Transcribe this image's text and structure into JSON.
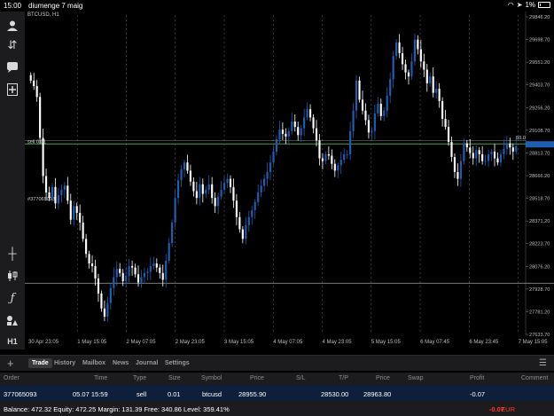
{
  "status_bar": {
    "time": "15:00",
    "date": "diumenge 7 maig",
    "battery": "1%"
  },
  "chart": {
    "symbol_title": "BTCUSD, H1",
    "price_labels": [
      "29846.20",
      "29698.70",
      "29551.20",
      "29403.70",
      "29256.20",
      "29108.70",
      "28813.70",
      "28666.20",
      "28518.70",
      "28371.20",
      "28223.70",
      "28076.20",
      "27928.70",
      "27781.20",
      "27633.70"
    ],
    "time_labels": [
      "30 Apr 23:05",
      "1 May 15:05",
      "2 May 07:05",
      "2 May 23:05",
      "3 May 15:05",
      "4 May 07:05",
      "4 May 23:05",
      "5 May 15:05",
      "6 May 07:45",
      "6 May 23:45",
      "7 May 15:05"
    ],
    "sell_line_label": "sell 0.01",
    "order_label": "#377065093",
    "level_value": "50.0",
    "colors": {
      "bull": "#1e5fb4",
      "bear": "#ffffff",
      "sell_line": "#3ea84b",
      "level_line": "#8a8a8a",
      "bid_tag": "#1e5fb4"
    }
  },
  "tabs": [
    "Trade",
    "History",
    "Mailbox",
    "News",
    "Journal",
    "Settings"
  ],
  "columns": [
    "Order",
    "Time",
    "Type",
    "Size",
    "Symbol",
    "Price",
    "S/L",
    "T/P",
    "Price",
    "Swap",
    "Profit",
    "Comment"
  ],
  "trade": {
    "order": "377065093",
    "time": "05.07 15:59",
    "type": "sell",
    "size": "0.01",
    "symbol": "btcusd",
    "price": "28955.90",
    "sl": "",
    "tp": "28530.00",
    "current_price": "28963.80",
    "swap": "",
    "profit": "-0.07",
    "comment": ""
  },
  "balance": {
    "text": "Balance: 472.32 Equity: 472.25 Margin: 131.39 Free: 340.86 Level: 359.41%",
    "profit": "-0.07",
    "currency": "EUR"
  },
  "chart_data": {
    "type": "candlestick",
    "title": "BTCUSD, H1",
    "ylim": [
      27560,
      29900
    ],
    "sell_price": 28955.9,
    "grid": true,
    "closes": [
      29420,
      29380,
      29300,
      29000,
      28720,
      28600,
      28560,
      28640,
      28520,
      28580,
      28620,
      28650,
      28540,
      28400,
      28500,
      28450,
      28380,
      28260,
      28150,
      28080,
      28060,
      27970,
      27860,
      27750,
      27690,
      27790,
      27900,
      27980,
      28040,
      28010,
      27950,
      27990,
      28060,
      28050,
      28000,
      27940,
      27980,
      28010,
      28020,
      28060,
      28080,
      28050,
      28010,
      27960,
      28100,
      28230,
      28380,
      28560,
      28690,
      28770,
      28820,
      28760,
      28680,
      28610,
      28560,
      28660,
      28590,
      28620,
      28660,
      28560,
      28500,
      28570,
      28620,
      28670,
      28700,
      28640,
      28540,
      28420,
      28330,
      28260,
      28360,
      28420,
      28470,
      28530,
      28600,
      28650,
      28700,
      28750,
      28820,
      28900,
      28990,
      29060,
      29030,
      29010,
      29050,
      29120,
      29080,
      29020,
      29070,
      29150,
      29210,
      29150,
      29070,
      28980,
      28850,
      28830,
      28880,
      28870,
      28810,
      28760,
      28800,
      28840,
      28880,
      28880,
      29050,
      29200,
      29420,
      29280,
      29200,
      29130,
      29040,
      29050,
      29180,
      29250,
      29160,
      29200,
      29310,
      29430,
      29600,
      29700,
      29620,
      29540,
      29480,
      29450,
      29560,
      29720,
      29650,
      29560,
      29500,
      29400,
      29450,
      29330,
      29360,
      29270,
      29140,
      29080,
      28970,
      28860,
      28750,
      28700,
      28830,
      28960,
      28930,
      28890,
      28850,
      28910,
      28880,
      28830,
      28830,
      28880,
      28900,
      28850,
      28820,
      28880,
      28920,
      28960,
      28930,
      28900,
      28940
    ]
  }
}
